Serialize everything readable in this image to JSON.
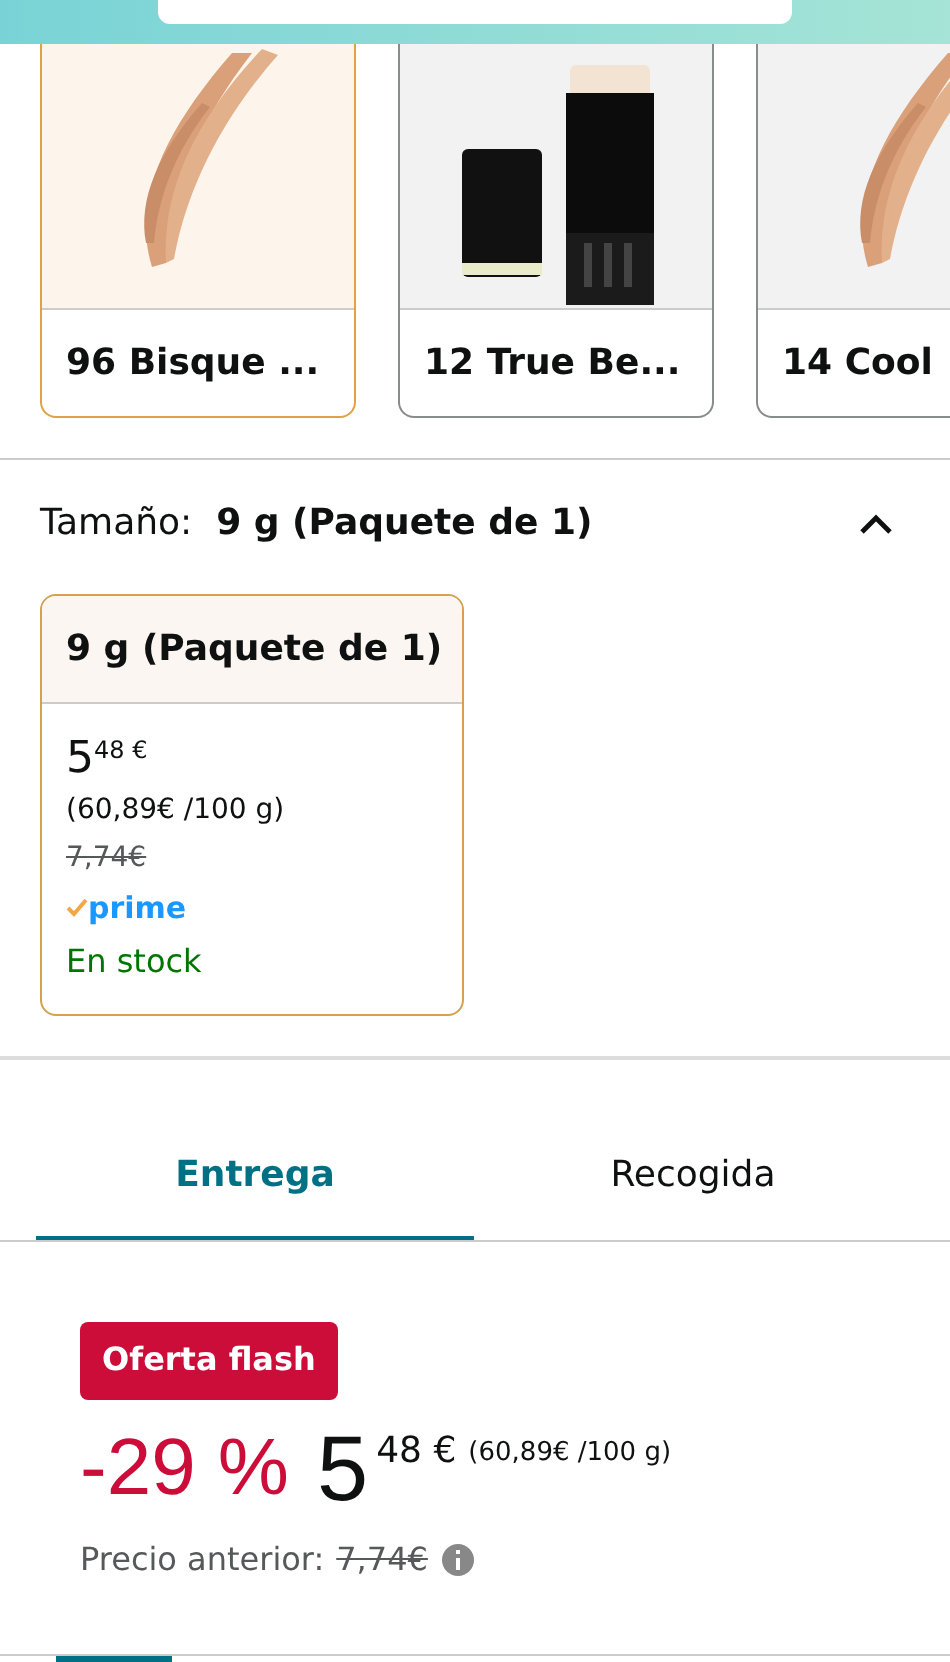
{
  "swatches": [
    {
      "label": "96 Bisque ...",
      "selected": true
    },
    {
      "label": "12 True Be...",
      "selected": false
    },
    {
      "label": "14 Cool",
      "selected": false
    }
  ],
  "size": {
    "label": "Tamaño:",
    "value": "9 g (Paquete de 1)",
    "expanded": true
  },
  "size_options": [
    {
      "title": "9 g (Paquete de 1)",
      "selected": true,
      "price_whole": "5",
      "price_fraction": "48 €",
      "unit_price": "(60,89€ /100 g)",
      "list_price": "7,74€",
      "prime": "prime",
      "availability": "En stock"
    }
  ],
  "tabs": [
    {
      "label": "Entrega",
      "selected": true
    },
    {
      "label": "Recogida",
      "selected": false
    }
  ],
  "offer": {
    "badge": "Oferta flash",
    "discount": "-29 %",
    "price_whole": "5",
    "price_fraction": "48 €",
    "unit_price": "(60,89€ /100 g)",
    "previous_label": "Precio anterior:",
    "previous_price": "7,74€"
  }
}
